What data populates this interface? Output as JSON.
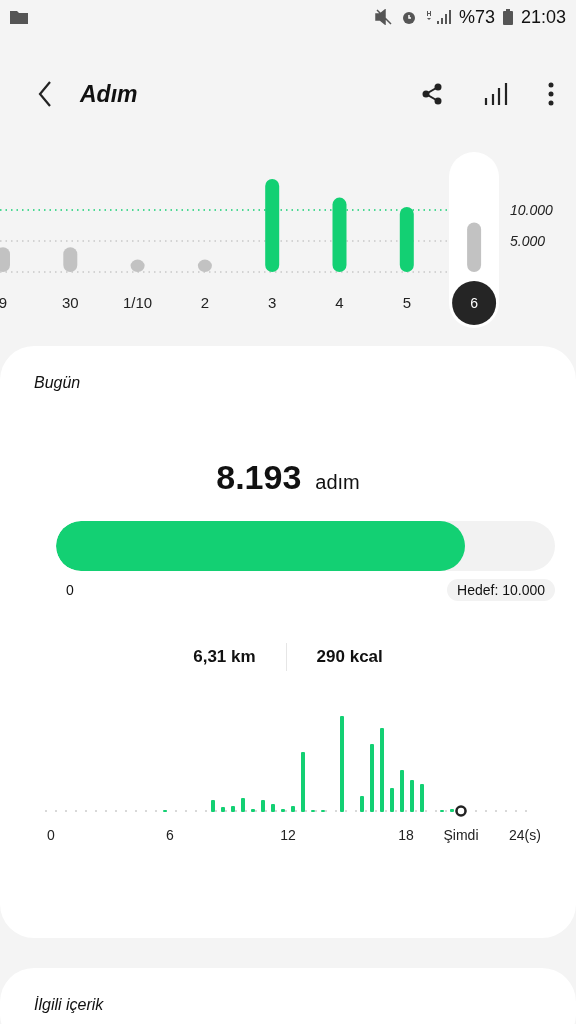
{
  "status_bar": {
    "battery": "%73",
    "time": "21:03"
  },
  "header": {
    "title": "Adım"
  },
  "day_chart": {
    "selected_day": "6",
    "chart_data": {
      "type": "bar",
      "categories": [
        "9",
        "30",
        "1/10",
        "2",
        "3",
        "4",
        "5",
        "6"
      ],
      "values": [
        4000,
        4000,
        2000,
        2000,
        15000,
        12000,
        10500,
        8000
      ],
      "ylim": [
        0,
        15000
      ],
      "yticks": [
        {
          "value": 5000,
          "label": "5.000"
        },
        {
          "value": 10000,
          "label": "10.000"
        }
      ]
    }
  },
  "today": {
    "title": "Bugün",
    "steps": "8.193",
    "unit": "adım",
    "progress": {
      "level": 0.8193,
      "start": "0",
      "goal": "Hedef: 10.000"
    },
    "distance": "6,31 km",
    "calories": "290 kcal",
    "hourly_axis": [
      "0",
      "6",
      "12",
      "18",
      "Şimdi",
      "24(s)"
    ]
  },
  "related": {
    "title": "İlgili içerik"
  }
}
